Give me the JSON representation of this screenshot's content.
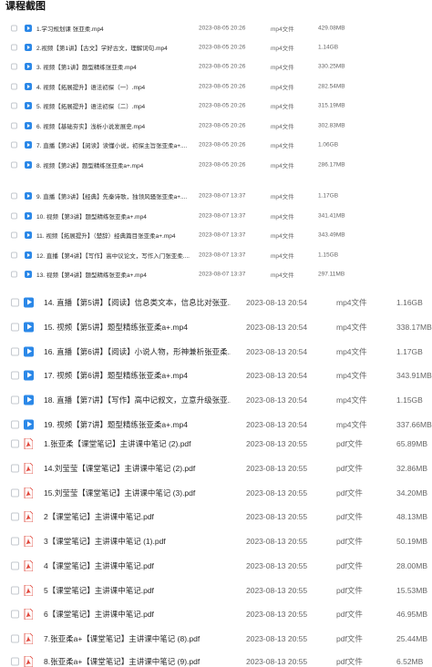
{
  "page_title": "课程截图",
  "colors": {
    "video_icon": "#2b88e8",
    "pdf_icon": "#e0463a",
    "checkbox_border": "#c5c9cf"
  },
  "rows": [
    {
      "icon": "video-icon",
      "name": "1.学习规划课 张亚柔.mp4",
      "date": "2023-08-05 20:26",
      "type": "mp4文件",
      "size": "429.08MB"
    },
    {
      "icon": "video-icon",
      "name": "2.视频【第1讲】【古文】学好古文，理解词句.mp4",
      "date": "2023-08-05 20:26",
      "type": "mp4文件",
      "size": "1.14GB"
    },
    {
      "icon": "video-icon",
      "name": "3. 视频【第1讲】题型精练张亚柔.mp4",
      "date": "2023-08-05 20:26",
      "type": "mp4文件",
      "size": "330.25MB"
    },
    {
      "icon": "video-icon",
      "name": "4. 视频【拓展提升】语法初探（一）.mp4",
      "date": "2023-08-05 20:26",
      "type": "mp4文件",
      "size": "282.54MB"
    },
    {
      "icon": "video-icon",
      "name": "5. 视频【拓展提升】语法初探（二）.mp4",
      "date": "2023-08-05 20:26",
      "type": "mp4文件",
      "size": "315.19MB"
    },
    {
      "icon": "video-icon",
      "name": "6. 视频【基础夯实】浅析小说发展史.mp4",
      "date": "2023-08-05 20:26",
      "type": "mp4文件",
      "size": "302.83MB"
    },
    {
      "icon": "video-icon",
      "name": "7. 直播【第2讲】【阅读】读懂小说，初探主旨张亚柔a+....",
      "date": "2023-08-05 20:26",
      "type": "mp4文件",
      "size": "1.06GB"
    },
    {
      "icon": "video-icon",
      "name": "8. 视频【第2讲】题型精练张亚柔a+.mp4",
      "date": "2023-08-05 20:26",
      "type": "mp4文件",
      "size": "286.17MB"
    },
    {
      "icon": "video-icon",
      "name": "9. 直播【第3讲】【经典】先秦诗歌，独领风骚张亚柔a+....",
      "date": "2023-08-07 13:37",
      "type": "mp4文件",
      "size": "1.17GB"
    },
    {
      "icon": "video-icon",
      "name": "10. 视频【第3讲】题型精练张亚柔a+.mp4",
      "date": "2023-08-07 13:37",
      "type": "mp4文件",
      "size": "341.41MB"
    },
    {
      "icon": "video-icon",
      "name": "11. 视频【拓展提升】（楚辞）经典篇目张亚柔a+.mp4",
      "date": "2023-08-07 13:37",
      "type": "mp4文件",
      "size": "343.49MB"
    },
    {
      "icon": "video-icon",
      "name": "12. 直播【第4讲】【写作】高中议论文，写作入门张亚柔....",
      "date": "2023-08-07 13:37",
      "type": "mp4文件",
      "size": "1.15GB"
    },
    {
      "icon": "video-icon",
      "name": "13. 视频【第4讲】题型精练张亚柔a+.mp4",
      "date": "2023-08-07 13:37",
      "type": "mp4文件",
      "size": "297.11MB"
    },
    {
      "icon": "video-icon",
      "name": "14. 直播【第5讲】【阅读】信息类文本，信息比对张亚...",
      "date": "2023-08-13 20:54",
      "type": "mp4文件",
      "size": "1.16GB"
    },
    {
      "icon": "video-icon",
      "name": "15. 视频【第5讲】题型精练张亚柔a+.mp4",
      "date": "2023-08-13 20:54",
      "type": "mp4文件",
      "size": "338.17MB"
    },
    {
      "icon": "video-icon",
      "name": "16. 直播【第6讲】【阅读】小说人物，形神兼析张亚柔....",
      "date": "2023-08-13 20:54",
      "type": "mp4文件",
      "size": "1.17GB"
    },
    {
      "icon": "video-icon",
      "name": "17. 视频【第6讲】题型精练张亚柔a+.mp4",
      "date": "2023-08-13 20:54",
      "type": "mp4文件",
      "size": "343.91MB"
    },
    {
      "icon": "video-icon",
      "name": "18. 直播【第7讲】【写作】高中记叙文，立意升级张亚...",
      "date": "2023-08-13 20:54",
      "type": "mp4文件",
      "size": "1.15GB"
    },
    {
      "icon": "video-icon",
      "name": "19. 视频【第7讲】题型精练张亚柔a+.mp4",
      "date": "2023-08-13 20:54",
      "type": "mp4文件",
      "size": "337.66MB"
    },
    {
      "icon": "pdf-icon",
      "name": "1.张亚柔【课堂笔记】主讲课中笔记 (2).pdf",
      "date": "2023-08-13 20:55",
      "type": "pdf文件",
      "size": "65.89MB"
    },
    {
      "icon": "pdf-icon",
      "name": "14.刘莹莹【课堂笔记】主讲课中笔记 (2).pdf",
      "date": "2023-08-13 20:55",
      "type": "pdf文件",
      "size": "32.86MB"
    },
    {
      "icon": "pdf-icon",
      "name": "15.刘莹莹【课堂笔记】主讲课中笔记 (3).pdf",
      "date": "2023-08-13 20:55",
      "type": "pdf文件",
      "size": "34.20MB"
    },
    {
      "icon": "pdf-icon",
      "name": "2【课堂笔记】主讲课中笔记.pdf",
      "date": "2023-08-13 20:55",
      "type": "pdf文件",
      "size": "48.13MB"
    },
    {
      "icon": "pdf-icon",
      "name": "3【课堂笔记】主讲课中笔记 (1).pdf",
      "date": "2023-08-13 20:55",
      "type": "pdf文件",
      "size": "50.19MB"
    },
    {
      "icon": "pdf-icon",
      "name": "4【课堂笔记】主讲课中笔记.pdf",
      "date": "2023-08-13 20:55",
      "type": "pdf文件",
      "size": "28.00MB"
    },
    {
      "icon": "pdf-icon",
      "name": "5【课堂笔记】主讲课中笔记.pdf",
      "date": "2023-08-13 20:55",
      "type": "pdf文件",
      "size": "15.53MB"
    },
    {
      "icon": "pdf-icon",
      "name": "6【课堂笔记】主讲课中笔记.pdf",
      "date": "2023-08-13 20:55",
      "type": "pdf文件",
      "size": "46.95MB"
    },
    {
      "icon": "pdf-icon",
      "name": "7.张亚柔a+【课堂笔记】主讲课中笔记 (8).pdf",
      "date": "2023-08-13 20:55",
      "type": "pdf文件",
      "size": "25.44MB"
    },
    {
      "icon": "pdf-icon",
      "name": "8.张亚柔a+【课堂笔记】主讲课中笔记 (9).pdf",
      "date": "2023-08-13 20:55",
      "type": "pdf文件",
      "size": "6.52MB"
    }
  ]
}
